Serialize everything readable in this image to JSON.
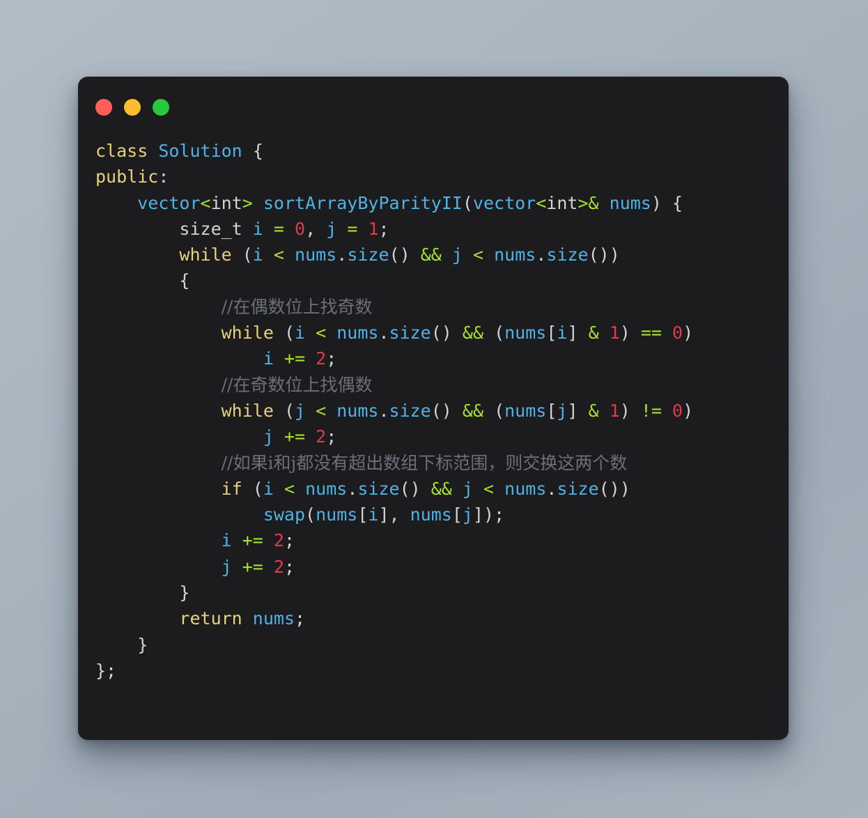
{
  "window": {
    "background_color": "#aab5bf",
    "surface_color": "#1c1c1e",
    "controls": [
      {
        "name": "close",
        "label": "",
        "color": "#ff5f56"
      },
      {
        "name": "minimize",
        "label": "",
        "color": "#ffbd2e"
      },
      {
        "name": "maximize",
        "label": "",
        "color": "#27c93f"
      }
    ]
  },
  "theme": {
    "plain": "#d4d4d4",
    "keyword": "#e6d27a",
    "type": "#4fb3e8",
    "identifier": "#4fb3e8",
    "number": "#e03a4b",
    "operator": "#a6e22e",
    "punctuation": "#d4d4d4",
    "comment": "#6a7079"
  },
  "code": {
    "language": "C++",
    "plain_text": "class Solution {\npublic:\n    vector<int> sortArrayByParityII(vector<int>& nums) {\n        size_t i = 0, j = 1;\n        while (i < nums.size() && j < nums.size())\n        {\n            //在偶数位上找奇数\n            while (i < nums.size() && (nums[i] & 1) == 0)\n                i += 2;\n            //在奇数位上找偶数\n            while (j < nums.size() && (nums[j] & 1) != 0)\n                j += 2;\n            //如果i和j都没有超出数组下标范围，则交换这两个数\n            if (i < nums.size() && j < nums.size())\n                swap(nums[i], nums[j]);\n            i += 2;\n            j += 2;\n        }\n        return nums;\n    }\n};",
    "lines": [
      {
        "id": 1,
        "text": "class Solution {"
      },
      {
        "id": 2,
        "text": "public:"
      },
      {
        "id": 3,
        "text": "    vector<int> sortArrayByParityII(vector<int>& nums) {"
      },
      {
        "id": 4,
        "text": "        size_t i = 0, j = 1;"
      },
      {
        "id": 5,
        "text": "        while (i < nums.size() && j < nums.size())"
      },
      {
        "id": 6,
        "text": "        {"
      },
      {
        "id": 7,
        "text": "            //在偶数位上找奇数"
      },
      {
        "id": 8,
        "text": "            while (i < nums.size() && (nums[i] & 1) == 0)"
      },
      {
        "id": 9,
        "text": "                i += 2;"
      },
      {
        "id": 10,
        "text": "            //在奇数位上找偶数"
      },
      {
        "id": 11,
        "text": "            while (j < nums.size() && (nums[j] & 1) != 0)"
      },
      {
        "id": 12,
        "text": "                j += 2;"
      },
      {
        "id": 13,
        "text": "            //如果i和j都没有超出数组下标范围，则交换这两个数"
      },
      {
        "id": 14,
        "text": "            if (i < nums.size() && j < nums.size())"
      },
      {
        "id": 15,
        "text": "                swap(nums[i], nums[j]);"
      },
      {
        "id": 16,
        "text": "            i += 2;"
      },
      {
        "id": 17,
        "text": "            j += 2;"
      },
      {
        "id": 18,
        "text": "        }"
      },
      {
        "id": 19,
        "text": "        return nums;"
      },
      {
        "id": 20,
        "text": "    }"
      },
      {
        "id": 21,
        "text": "};"
      }
    ],
    "comments": [
      "//在偶数位上找奇数",
      "//在奇数位上找偶数",
      "//如果i和j都没有超出数组下标范围，则交换这两个数"
    ],
    "tokens": [
      [
        {
          "t": "class",
          "c": "keyword"
        },
        {
          "t": " ",
          "c": "plain"
        },
        {
          "t": "Solution",
          "c": "type"
        },
        {
          "t": " ",
          "c": "plain"
        },
        {
          "t": "{",
          "c": "punct"
        }
      ],
      [
        {
          "t": "public",
          "c": "keyword"
        },
        {
          "t": ":",
          "c": "punct"
        }
      ],
      [
        {
          "t": "    ",
          "c": "plain"
        },
        {
          "t": "vector",
          "c": "type"
        },
        {
          "t": "<",
          "c": "operator"
        },
        {
          "t": "int",
          "c": "plain"
        },
        {
          "t": ">",
          "c": "operator"
        },
        {
          "t": " ",
          "c": "plain"
        },
        {
          "t": "sortArrayByParityII",
          "c": "func"
        },
        {
          "t": "(",
          "c": "punct"
        },
        {
          "t": "vector",
          "c": "type"
        },
        {
          "t": "<",
          "c": "operator"
        },
        {
          "t": "int",
          "c": "plain"
        },
        {
          "t": ">",
          "c": "operator"
        },
        {
          "t": "&",
          "c": "operator"
        },
        {
          "t": " ",
          "c": "plain"
        },
        {
          "t": "nums",
          "c": "ident"
        },
        {
          "t": ")",
          "c": "punct"
        },
        {
          "t": " ",
          "c": "plain"
        },
        {
          "t": "{",
          "c": "punct"
        }
      ],
      [
        {
          "t": "        ",
          "c": "plain"
        },
        {
          "t": "size_t",
          "c": "plain"
        },
        {
          "t": " ",
          "c": "plain"
        },
        {
          "t": "i",
          "c": "ident"
        },
        {
          "t": " ",
          "c": "plain"
        },
        {
          "t": "=",
          "c": "operator"
        },
        {
          "t": " ",
          "c": "plain"
        },
        {
          "t": "0",
          "c": "number"
        },
        {
          "t": ", ",
          "c": "punct"
        },
        {
          "t": "j",
          "c": "ident"
        },
        {
          "t": " ",
          "c": "plain"
        },
        {
          "t": "=",
          "c": "operator"
        },
        {
          "t": " ",
          "c": "plain"
        },
        {
          "t": "1",
          "c": "number"
        },
        {
          "t": ";",
          "c": "punct"
        }
      ],
      [
        {
          "t": "        ",
          "c": "plain"
        },
        {
          "t": "while",
          "c": "keyword"
        },
        {
          "t": " (",
          "c": "punct"
        },
        {
          "t": "i",
          "c": "ident"
        },
        {
          "t": " ",
          "c": "plain"
        },
        {
          "t": "<",
          "c": "operator"
        },
        {
          "t": " ",
          "c": "plain"
        },
        {
          "t": "nums",
          "c": "ident"
        },
        {
          "t": ".",
          "c": "punct"
        },
        {
          "t": "size",
          "c": "func"
        },
        {
          "t": "() ",
          "c": "punct"
        },
        {
          "t": "&&",
          "c": "operator"
        },
        {
          "t": " ",
          "c": "plain"
        },
        {
          "t": "j",
          "c": "ident"
        },
        {
          "t": " ",
          "c": "plain"
        },
        {
          "t": "<",
          "c": "operator"
        },
        {
          "t": " ",
          "c": "plain"
        },
        {
          "t": "nums",
          "c": "ident"
        },
        {
          "t": ".",
          "c": "punct"
        },
        {
          "t": "size",
          "c": "func"
        },
        {
          "t": "())",
          "c": "punct"
        }
      ],
      [
        {
          "t": "        ",
          "c": "plain"
        },
        {
          "t": "{",
          "c": "punct"
        }
      ],
      [
        {
          "t": "            ",
          "c": "plain"
        },
        {
          "t": "//在偶数位上找奇数",
          "c": "comment-cn"
        }
      ],
      [
        {
          "t": "            ",
          "c": "plain"
        },
        {
          "t": "while",
          "c": "keyword"
        },
        {
          "t": " (",
          "c": "punct"
        },
        {
          "t": "i",
          "c": "ident"
        },
        {
          "t": " ",
          "c": "plain"
        },
        {
          "t": "<",
          "c": "operator"
        },
        {
          "t": " ",
          "c": "plain"
        },
        {
          "t": "nums",
          "c": "ident"
        },
        {
          "t": ".",
          "c": "punct"
        },
        {
          "t": "size",
          "c": "func"
        },
        {
          "t": "() ",
          "c": "punct"
        },
        {
          "t": "&&",
          "c": "operator"
        },
        {
          "t": " (",
          "c": "punct"
        },
        {
          "t": "nums",
          "c": "ident"
        },
        {
          "t": "[",
          "c": "punct"
        },
        {
          "t": "i",
          "c": "ident"
        },
        {
          "t": "] ",
          "c": "punct"
        },
        {
          "t": "&",
          "c": "operator"
        },
        {
          "t": " ",
          "c": "plain"
        },
        {
          "t": "1",
          "c": "number"
        },
        {
          "t": ") ",
          "c": "punct"
        },
        {
          "t": "==",
          "c": "operator"
        },
        {
          "t": " ",
          "c": "plain"
        },
        {
          "t": "0",
          "c": "number"
        },
        {
          "t": ")",
          "c": "punct"
        }
      ],
      [
        {
          "t": "                ",
          "c": "plain"
        },
        {
          "t": "i",
          "c": "ident"
        },
        {
          "t": " ",
          "c": "plain"
        },
        {
          "t": "+=",
          "c": "operator"
        },
        {
          "t": " ",
          "c": "plain"
        },
        {
          "t": "2",
          "c": "number"
        },
        {
          "t": ";",
          "c": "punct"
        }
      ],
      [
        {
          "t": "            ",
          "c": "plain"
        },
        {
          "t": "//在奇数位上找偶数",
          "c": "comment-cn"
        }
      ],
      [
        {
          "t": "            ",
          "c": "plain"
        },
        {
          "t": "while",
          "c": "keyword"
        },
        {
          "t": " (",
          "c": "punct"
        },
        {
          "t": "j",
          "c": "ident"
        },
        {
          "t": " ",
          "c": "plain"
        },
        {
          "t": "<",
          "c": "operator"
        },
        {
          "t": " ",
          "c": "plain"
        },
        {
          "t": "nums",
          "c": "ident"
        },
        {
          "t": ".",
          "c": "punct"
        },
        {
          "t": "size",
          "c": "func"
        },
        {
          "t": "() ",
          "c": "punct"
        },
        {
          "t": "&&",
          "c": "operator"
        },
        {
          "t": " (",
          "c": "punct"
        },
        {
          "t": "nums",
          "c": "ident"
        },
        {
          "t": "[",
          "c": "punct"
        },
        {
          "t": "j",
          "c": "ident"
        },
        {
          "t": "] ",
          "c": "punct"
        },
        {
          "t": "&",
          "c": "operator"
        },
        {
          "t": " ",
          "c": "plain"
        },
        {
          "t": "1",
          "c": "number"
        },
        {
          "t": ") ",
          "c": "punct"
        },
        {
          "t": "!=",
          "c": "operator"
        },
        {
          "t": " ",
          "c": "plain"
        },
        {
          "t": "0",
          "c": "number"
        },
        {
          "t": ")",
          "c": "punct"
        }
      ],
      [
        {
          "t": "                ",
          "c": "plain"
        },
        {
          "t": "j",
          "c": "ident"
        },
        {
          "t": " ",
          "c": "plain"
        },
        {
          "t": "+=",
          "c": "operator"
        },
        {
          "t": " ",
          "c": "plain"
        },
        {
          "t": "2",
          "c": "number"
        },
        {
          "t": ";",
          "c": "punct"
        }
      ],
      [
        {
          "t": "            ",
          "c": "plain"
        },
        {
          "t": "//如果i和j都没有超出数组下标范围，则交换这两个数",
          "c": "comment-cn"
        }
      ],
      [
        {
          "t": "            ",
          "c": "plain"
        },
        {
          "t": "if",
          "c": "keyword"
        },
        {
          "t": " (",
          "c": "punct"
        },
        {
          "t": "i",
          "c": "ident"
        },
        {
          "t": " ",
          "c": "plain"
        },
        {
          "t": "<",
          "c": "operator"
        },
        {
          "t": " ",
          "c": "plain"
        },
        {
          "t": "nums",
          "c": "ident"
        },
        {
          "t": ".",
          "c": "punct"
        },
        {
          "t": "size",
          "c": "func"
        },
        {
          "t": "() ",
          "c": "punct"
        },
        {
          "t": "&&",
          "c": "operator"
        },
        {
          "t": " ",
          "c": "plain"
        },
        {
          "t": "j",
          "c": "ident"
        },
        {
          "t": " ",
          "c": "plain"
        },
        {
          "t": "<",
          "c": "operator"
        },
        {
          "t": " ",
          "c": "plain"
        },
        {
          "t": "nums",
          "c": "ident"
        },
        {
          "t": ".",
          "c": "punct"
        },
        {
          "t": "size",
          "c": "func"
        },
        {
          "t": "())",
          "c": "punct"
        }
      ],
      [
        {
          "t": "                ",
          "c": "plain"
        },
        {
          "t": "swap",
          "c": "func"
        },
        {
          "t": "(",
          "c": "punct"
        },
        {
          "t": "nums",
          "c": "ident"
        },
        {
          "t": "[",
          "c": "punct"
        },
        {
          "t": "i",
          "c": "ident"
        },
        {
          "t": "], ",
          "c": "punct"
        },
        {
          "t": "nums",
          "c": "ident"
        },
        {
          "t": "[",
          "c": "punct"
        },
        {
          "t": "j",
          "c": "ident"
        },
        {
          "t": "]);",
          "c": "punct"
        }
      ],
      [
        {
          "t": "            ",
          "c": "plain"
        },
        {
          "t": "i",
          "c": "ident"
        },
        {
          "t": " ",
          "c": "plain"
        },
        {
          "t": "+=",
          "c": "operator"
        },
        {
          "t": " ",
          "c": "plain"
        },
        {
          "t": "2",
          "c": "number"
        },
        {
          "t": ";",
          "c": "punct"
        }
      ],
      [
        {
          "t": "            ",
          "c": "plain"
        },
        {
          "t": "j",
          "c": "ident"
        },
        {
          "t": " ",
          "c": "plain"
        },
        {
          "t": "+=",
          "c": "operator"
        },
        {
          "t": " ",
          "c": "plain"
        },
        {
          "t": "2",
          "c": "number"
        },
        {
          "t": ";",
          "c": "punct"
        }
      ],
      [
        {
          "t": "        ",
          "c": "plain"
        },
        {
          "t": "}",
          "c": "punct"
        }
      ],
      [
        {
          "t": "        ",
          "c": "plain"
        },
        {
          "t": "return",
          "c": "keyword"
        },
        {
          "t": " ",
          "c": "plain"
        },
        {
          "t": "nums",
          "c": "ident"
        },
        {
          "t": ";",
          "c": "punct"
        }
      ],
      [
        {
          "t": "    ",
          "c": "plain"
        },
        {
          "t": "}",
          "c": "punct"
        }
      ],
      [
        {
          "t": "};",
          "c": "punct"
        }
      ]
    ]
  }
}
